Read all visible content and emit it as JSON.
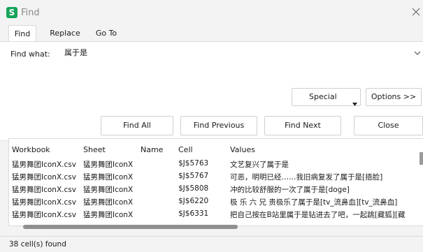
{
  "window": {
    "app_icon_letter": "S",
    "title": "Find"
  },
  "tabs": [
    {
      "label": "Find"
    },
    {
      "label": "Replace"
    },
    {
      "label": "Go To"
    }
  ],
  "find_what": {
    "label": "Find what:",
    "value": "属于是"
  },
  "buttons": {
    "special": "Special",
    "options": "Options >>",
    "find_all": "Find All",
    "find_previous": "Find Previous",
    "find_next": "Find Next",
    "close": "Close"
  },
  "results": {
    "columns": [
      "Workbook",
      "Sheet",
      "Name",
      "Cell",
      "Values"
    ],
    "rows": [
      {
        "workbook": "猛男舞团IconX.csv",
        "sheet": "猛男舞团IconX",
        "name": "",
        "cell": "$J$5763",
        "value": "文艺复兴了属于是"
      },
      {
        "workbook": "猛男舞团IconX.csv",
        "sheet": "猛男舞团IconX",
        "name": "",
        "cell": "$J$5767",
        "value": "可恶，明明已经……我旧病复发了属于是[捂脸]"
      },
      {
        "workbook": "猛男舞团IconX.csv",
        "sheet": "猛男舞团IconX",
        "name": "",
        "cell": "$J$5808",
        "value": "冲的比较舒服的一次了属于是[doge]"
      },
      {
        "workbook": "猛男舞团IconX.csv",
        "sheet": "猛男舞团IconX",
        "name": "",
        "cell": "$J$6220",
        "value": "极 乐 六 兄 贵极乐了属于是[tv_流鼻血][tv_流鼻血]"
      },
      {
        "workbook": "猛男舞团IconX.csv",
        "sheet": "猛男舞团IconX",
        "name": "",
        "cell": "$J$6331",
        "value": "把自己按在B站里属于是钻进去了吧，一起跳[藏狐][藏"
      }
    ]
  },
  "status": {
    "text": "38 cell(s) found"
  },
  "colors": {
    "app_icon": "#17a35a",
    "panel_bg": "#ffffff",
    "window_bg": "#f3f3f3"
  }
}
